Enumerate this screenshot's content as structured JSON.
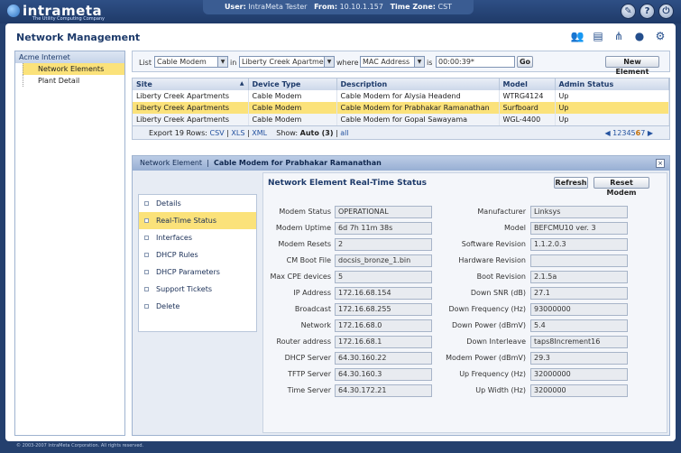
{
  "app": {
    "brand": "intrameta",
    "tagline": "The Utility Computing Company"
  },
  "session": {
    "user_label": "User:",
    "user": "IntraMeta Tester",
    "from_label": "From:",
    "from": "10.10.1.157",
    "tz_label": "Time Zone:",
    "tz": "CST"
  },
  "page_title": "Network Management",
  "nav": {
    "root": "Acme Internet",
    "items": [
      {
        "label": "Network Elements"
      },
      {
        "label": "Plant Detail"
      }
    ]
  },
  "filter": {
    "list_label": "List",
    "list_value": "Cable Modem",
    "in_label": "in",
    "in_value": "Liberty Creek Apartments",
    "where_label": "where",
    "where_value": "MAC Address",
    "is_label": "is",
    "is_value": "00:00:39*",
    "go_label": "Go",
    "new_label": "New Element"
  },
  "grid": {
    "columns": [
      "Site",
      "Device Type",
      "Description",
      "Model",
      "Admin Status"
    ],
    "rows": [
      [
        "Liberty Creek Apartments",
        "Cable Modem",
        "Cable Modem for Alysia Headend",
        "WTRG4124",
        "Up"
      ],
      [
        "Liberty Creek Apartments",
        "Cable Modem",
        "Cable Modem for Prabhakar Ramanathan",
        "Surfboard",
        "Up"
      ],
      [
        "Liberty Creek Apartments",
        "Cable Modem",
        "Cable Modem for Gopal Sawayama",
        "WGL-4400",
        "Up"
      ]
    ],
    "export_label": "Export 19 Rows:",
    "csv": "CSV",
    "xls": "XLS",
    "xml": "XML",
    "show_label": "Show:",
    "show_value": "Auto (3)",
    "all": "all",
    "pages": [
      "1",
      "2",
      "3",
      "4",
      "5",
      "6",
      "7"
    ],
    "current_page": "6"
  },
  "detail": {
    "crumb": "Network Element",
    "sep": "|",
    "title": "Cable Modem for Prabhakar Ramanathan",
    "tabs": [
      "Details",
      "Real-Time Status",
      "Interfaces",
      "DHCP Rules",
      "DHCP Parameters",
      "Support Tickets",
      "Delete"
    ],
    "panel_title": "Network Element Real-Time Status",
    "refresh": "Refresh",
    "reset": "Reset Modem",
    "left_fields": [
      {
        "label": "Modem Status",
        "value": "OPERATIONAL"
      },
      {
        "label": "Modem Uptime",
        "value": "6d 7h 11m 38s"
      },
      {
        "label": "Modem Resets",
        "value": "2"
      },
      {
        "label": "CM Boot File",
        "value": "docsis_bronze_1.bin"
      },
      {
        "label": "Max CPE devices",
        "value": "5"
      },
      {
        "label": "IP Address",
        "value": "172.16.68.154"
      },
      {
        "label": "Broadcast",
        "value": "172.16.68.255"
      },
      {
        "label": "Network",
        "value": "172.16.68.0"
      },
      {
        "label": "Router address",
        "value": "172.16.68.1"
      },
      {
        "label": "DHCP Server",
        "value": "64.30.160.22"
      },
      {
        "label": "TFTP Server",
        "value": "64.30.160.3"
      },
      {
        "label": "Time Server",
        "value": "64.30.172.21"
      }
    ],
    "right_fields": [
      {
        "label": "Manufacturer",
        "value": "Linksys"
      },
      {
        "label": "Model",
        "value": "BEFCMU10 ver. 3"
      },
      {
        "label": "Software Revision",
        "value": "1.1.2.0.3"
      },
      {
        "label": "Hardware Revision",
        "value": ""
      },
      {
        "label": "Boot Revision",
        "value": "2.1.5a"
      },
      {
        "label": "Down SNR (dB)",
        "value": "27.1"
      },
      {
        "label": "Down Frequency (Hz)",
        "value": "93000000"
      },
      {
        "label": "Down Power (dBmV)",
        "value": "5.4"
      },
      {
        "label": "Down Interleave",
        "value": "taps8Increment16"
      },
      {
        "label": "Modem Power (dBmV)",
        "value": "29.3"
      },
      {
        "label": "Up Frequency (Hz)",
        "value": "32000000"
      },
      {
        "label": "Up Width (Hz)",
        "value": "3200000"
      }
    ]
  },
  "footer": "© 2003-2007 IntraMeta Corporation. All rights reserved."
}
